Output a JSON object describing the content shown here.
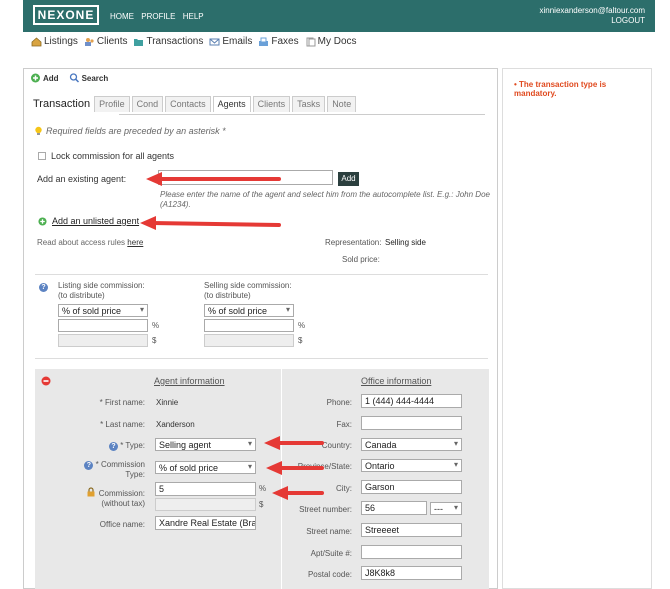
{
  "header": {
    "logo": "NEXONE",
    "nav": [
      "HOME",
      "PROFILE",
      "HELP"
    ],
    "user_email": "xinniexanderson@faltour.com",
    "logout": "LOGOUT"
  },
  "mainnav": [
    {
      "label": "Listings",
      "icon": "house-icon"
    },
    {
      "label": "Clients",
      "icon": "clients-icon"
    },
    {
      "label": "Transactions",
      "icon": "folder-icon"
    },
    {
      "label": "Emails",
      "icon": "envelope-icon"
    },
    {
      "label": "Faxes",
      "icon": "fax-icon"
    },
    {
      "label": "My Docs",
      "icon": "docs-icon"
    }
  ],
  "subnav": {
    "add": "Add",
    "search": "Search"
  },
  "tabs": {
    "active": "Transaction",
    "items": [
      "Profile",
      "Cond",
      "Contacts",
      "Agents",
      "Clients",
      "Tasks",
      "Note"
    ],
    "current": "Agents"
  },
  "errors": {
    "message": "The transaction type is mandatory."
  },
  "form": {
    "required_note": "Required fields are preceded by an asterisk *",
    "lock_commission": "Lock commission for all agents",
    "existing_agent_label": "Add an existing agent:",
    "add_button": "Add",
    "autocomplete_hint": "Please enter the name of the agent and select him from the autocomplete list. E.g.: John Doe (A1234).",
    "unlisted_agent": "Add an unlisted agent",
    "access_rules_text": "Read about access rules",
    "access_rules_link": "here",
    "representation_label": "Representation:",
    "representation_value": "Selling side",
    "sold_price_label": "Sold price:",
    "listing_commission_label": "Listing side commission:",
    "selling_commission_label": "Selling side commission:",
    "to_distribute": "(to distribute)",
    "commission_type": "% of sold price",
    "pct": "%",
    "dollar": "$"
  },
  "agent": {
    "section_title": "Agent information",
    "first_name_label": "* First name:",
    "first_name": "Xinnie",
    "last_name_label": "* Last name:",
    "last_name": "Xanderson",
    "type_label": "* Type:",
    "type_value": "Selling agent",
    "commission_type_label": "* Commission Type:",
    "commission_type_value": "% of sold price",
    "commission_label": "Commission:",
    "commission_sub": "(without tax)",
    "commission_value": "5",
    "office_name_label": "Office name:",
    "office_name": "Xandre Real Estate (Bra"
  },
  "office": {
    "section_title": "Office information",
    "phone_label": "Phone:",
    "phone": "1 (444) 444-4444",
    "fax_label": "Fax:",
    "fax": "",
    "country_label": "Country:",
    "country": "Canada",
    "province_label": "Province/State:",
    "province": "Ontario",
    "city_label": "City:",
    "city": "Garson",
    "street_number_label": "Street number:",
    "street_number": "56",
    "street_suffix": "---",
    "street_name_label": "Street name:",
    "street_name": "Streeeet",
    "apt_label": "Apt/Suite #:",
    "apt": "",
    "postal_label": "Postal code:",
    "postal": "J8K8k8"
  },
  "colors": {
    "header": "#2c6e6b",
    "arrow": "#e53935",
    "error": "#e04a1f",
    "button": "#2b3f3e"
  }
}
